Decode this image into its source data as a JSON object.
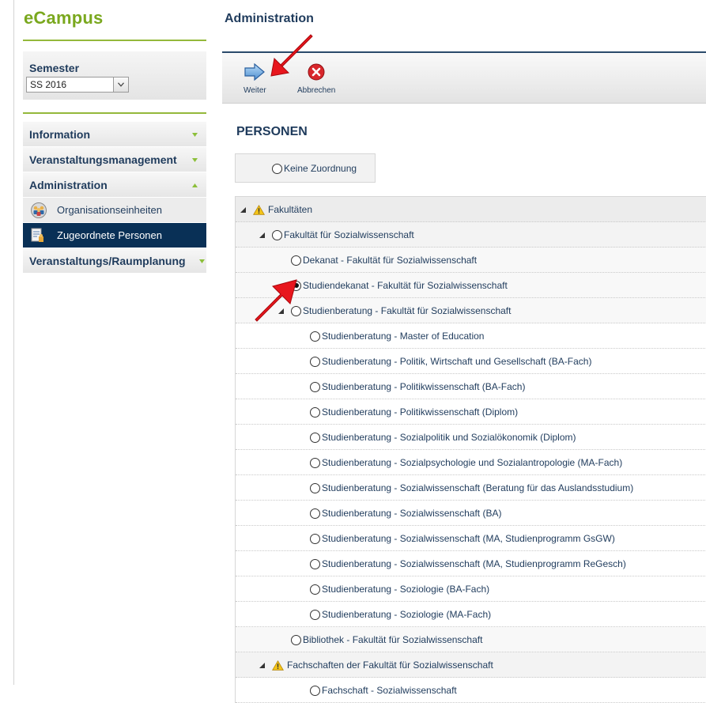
{
  "app": {
    "logo": "eCampus"
  },
  "semester": {
    "label": "Semester",
    "selected": "SS 2016"
  },
  "nav": {
    "information": "Information",
    "veranstaltungsmanagement": "Veranstaltungsmanagement",
    "administration": "Administration",
    "organisationseinheiten": "Organisationseinheiten",
    "zugeordnete_personen": "Zugeordnete Personen",
    "raumplanung": "Veranstaltungs/Raumplanung"
  },
  "main": {
    "title": "Administration",
    "toolbar": {
      "weiter": "Weiter",
      "abbrechen": "Abbrechen"
    },
    "section_title": "PERSONEN",
    "keine_zuordnung": "Keine Zuordnung"
  },
  "tree": [
    {
      "label": "Fakultäten",
      "level": 0,
      "expander": true,
      "warning": true,
      "radio": false
    },
    {
      "label": "Fakultät für Sozialwissenschaft",
      "level": 1,
      "expander": true,
      "warning": false,
      "radio": true
    },
    {
      "label": "Dekanat - Fakultät für Sozialwissenschaft",
      "level": 2,
      "expander": false,
      "warning": false,
      "radio": true
    },
    {
      "label": "Studiendekanat - Fakultät für Sozialwissenschaft",
      "level": 2,
      "expander": false,
      "warning": false,
      "radio": true,
      "checked": true
    },
    {
      "label": "Studienberatung - Fakultät für Sozialwissenschaft",
      "level": 2,
      "expander": true,
      "warning": false,
      "radio": true
    },
    {
      "label": "Studienberatung - Master of Education",
      "level": 3,
      "expander": false,
      "warning": false,
      "radio": true
    },
    {
      "label": "Studienberatung - Politik, Wirtschaft und Gesellschaft (BA-Fach)",
      "level": 3,
      "expander": false,
      "warning": false,
      "radio": true
    },
    {
      "label": "Studienberatung - Politikwissenschaft (BA-Fach)",
      "level": 3,
      "expander": false,
      "warning": false,
      "radio": true
    },
    {
      "label": "Studienberatung - Politikwissenschaft (Diplom)",
      "level": 3,
      "expander": false,
      "warning": false,
      "radio": true
    },
    {
      "label": "Studienberatung - Sozialpolitik und Sozialökonomik (Diplom)",
      "level": 3,
      "expander": false,
      "warning": false,
      "radio": true
    },
    {
      "label": "Studienberatung - Sozialpsychologie und Sozialantropologie (MA-Fach)",
      "level": 3,
      "expander": false,
      "warning": false,
      "radio": true
    },
    {
      "label": "Studienberatung - Sozialwissenschaft (Beratung für das Auslandsstudium)",
      "level": 3,
      "expander": false,
      "warning": false,
      "radio": true
    },
    {
      "label": "Studienberatung - Sozialwissenschaft (BA)",
      "level": 3,
      "expander": false,
      "warning": false,
      "radio": true
    },
    {
      "label": "Studienberatung - Sozialwissenschaft (MA, Studienprogramm GsGW)",
      "level": 3,
      "expander": false,
      "warning": false,
      "radio": true
    },
    {
      "label": "Studienberatung - Sozialwissenschaft (MA, Studienprogramm ReGesch)",
      "level": 3,
      "expander": false,
      "warning": false,
      "radio": true
    },
    {
      "label": "Studienberatung - Soziologie (BA-Fach)",
      "level": 3,
      "expander": false,
      "warning": false,
      "radio": true
    },
    {
      "label": "Studienberatung - Soziologie (MA-Fach)",
      "level": 3,
      "expander": false,
      "warning": false,
      "radio": true
    },
    {
      "label": "Bibliothek - Fakultät für Sozialwissenschaft",
      "level": 2,
      "expander": false,
      "warning": false,
      "radio": true
    },
    {
      "label": "Fachschaften der Fakultät für Sozialwissenschaft",
      "level": 1,
      "expander": true,
      "warning": true,
      "radio": false
    },
    {
      "label": "Fachschaft - Sozialwissenschaft",
      "level": 3,
      "expander": false,
      "warning": false,
      "radio": true
    }
  ],
  "colors": {
    "brand_green": "#7aa81e",
    "nav_dark": "#093056",
    "text_blue": "#1f3b5c",
    "annotation_red": "#e8161d"
  }
}
